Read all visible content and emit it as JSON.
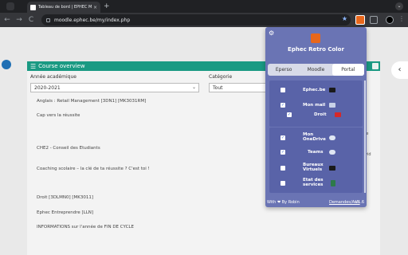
{
  "browser": {
    "tab_title": "Tableau de bord | EPHEC Mo",
    "tab_close": "×",
    "new_tab": "+",
    "url": "moodle.ephec.be/my/index.php",
    "back": "←",
    "forward": "→",
    "reload": "C",
    "star": "★",
    "menu": "⋮"
  },
  "page": {
    "overview_title": "Course overview",
    "year_label": "Année académique",
    "year_value": "2020-2021",
    "category_label": "Catégorie",
    "category_value": "Tout",
    "courses": [
      "Anglais : Retail Management [3DN1] [MK3031RM]",
      "Cap vers la réussite",
      "CHE2 - Conseil des Etudiants",
      "Coaching scolaire – la clé de ta réussite ? C'est toi !",
      "Droit [3DLMN0] [MK3011]",
      "Ephec Entreprendre [LLN]",
      "INFORMATIONS sur l'année de FIN DE CYCLE"
    ],
    "right_partial_1": "ie",
    "right_partial_2": "vid"
  },
  "popup": {
    "title": "Ephec Retro Color",
    "tabs": [
      "Eperso",
      "Moodle",
      "Portal"
    ],
    "active_tab": "Portal",
    "services": [
      {
        "label": "Ephec.be",
        "checked": false,
        "icon_color": "#1a1a1a"
      },
      {
        "label": "Mon mail",
        "checked": true,
        "icon_color": "#c8d2e8"
      },
      {
        "label": "Droit",
        "checked": true,
        "icon_color": "#d62828"
      },
      {
        "label": "Mon OneDrive",
        "checked": true,
        "icon_color": "#dfe6f3"
      },
      {
        "label": "Teams",
        "checked": true,
        "icon_color": "#dfe6f3"
      },
      {
        "label": "Bureaux Virtuels",
        "checked": false,
        "icon_color": "#1a1a1a"
      },
      {
        "label": "Etat des services",
        "checked": false,
        "icon_color": "#2d7a4a"
      }
    ],
    "footer_left": "With ❤ By Robin",
    "footer_mid": "Demandes/Avis",
    "footer_right": "V1.6"
  },
  "colors": {
    "accent": "#1a9a83",
    "popup_bg": "#6a74b4",
    "extension": "#e8671c"
  }
}
